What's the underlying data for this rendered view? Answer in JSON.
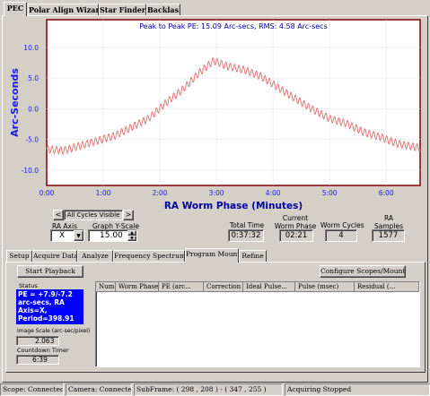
{
  "top_tabs": [
    "PEC",
    "Polar Align Wizard",
    "Star Finder",
    "Backlash"
  ],
  "colors": {
    "plot_border": "#800000",
    "curve": "#e07a7a",
    "axis_blue": "#1a1ae6",
    "title_navy": "#0000a0",
    "readout_bg": "#0000ff"
  },
  "chart_data": {
    "type": "line",
    "title": "Peak to Peak PE: 15.09 Arc-secs,  RMS: 4.58 Arc-secs",
    "xlabel": "RA Worm Phase (Minutes)",
    "ylabel": "Arc-Seconds",
    "x_ticks": [
      "0:00",
      "1:00",
      "2:00",
      "3:00",
      "4:00",
      "5:00",
      "6:00"
    ],
    "y_ticks": [
      "10.0",
      "5.0",
      "0.0",
      "-5.0",
      "-10.0"
    ],
    "xlim": [
      0,
      6.6
    ],
    "ylim": [
      -12.5,
      14.5
    ],
    "grid": true,
    "series": [
      {
        "x": [
          0,
          0.3,
          0.6,
          0.9,
          1.2,
          1.5,
          1.8,
          2.1,
          2.4,
          2.7,
          2.95,
          3.2,
          3.5,
          3.8,
          4.1,
          4.4,
          4.7,
          5.0,
          5.3,
          5.6,
          5.9,
          6.2,
          6.6
        ],
        "values": [
          -6.6,
          -6.8,
          -6.0,
          -5.2,
          -4.4,
          -3.0,
          -1.6,
          0.9,
          3.1,
          5.9,
          7.8,
          6.9,
          6.3,
          5.2,
          3.4,
          1.6,
          -0.1,
          -1.6,
          -2.4,
          -3.8,
          -4.6,
          -5.7,
          -6.4
        ]
      }
    ]
  },
  "controls": {
    "cycles_label": "All Cycles Visible",
    "prev_label": "<",
    "next_label": ">",
    "ra_axis_label": "RA Axis",
    "ra_axis_value": "X",
    "graph_scale_label": "Graph Y-Scale",
    "graph_scale_value": "15.00"
  },
  "stats": [
    {
      "label": "Total Time",
      "value": "0:37:32"
    },
    {
      "label": "Current Worm Phase",
      "value": "02:21"
    },
    {
      "label": "Worm Cycles",
      "value": "4"
    },
    {
      "label": "RA Samples",
      "value": "1577"
    }
  ],
  "bottom_tabs": [
    "Setup",
    "Acquire Data",
    "Analyze",
    "Frequency Spectrum",
    "Program Mount",
    "Refine"
  ],
  "program": {
    "start_button": "Start Playback",
    "configure_button": "Configure Scopes/Mounts",
    "status_label": "Status",
    "status_text": "PE = +7.9/-7.2 arc-secs, RA Axis=X, Period=398.91",
    "image_scale_label": "Image Scale (arc-sec/pixel)",
    "image_scale_value": "2.063",
    "countdown_label": "Countdown Timer",
    "countdown_value": "6:39",
    "table_columns": [
      "Num",
      "Worm Phase",
      "PE (arc...",
      "Correction",
      "Ideal Pulse...",
      "Pulse (msec)",
      "Residual (..."
    ]
  },
  "status_bar": [
    "Scope: Connected",
    "Camera: Connected",
    "SubFrame: ( 298 , 208 ) - ( 347 , 255 )",
    "Acquiring Stopped"
  ]
}
